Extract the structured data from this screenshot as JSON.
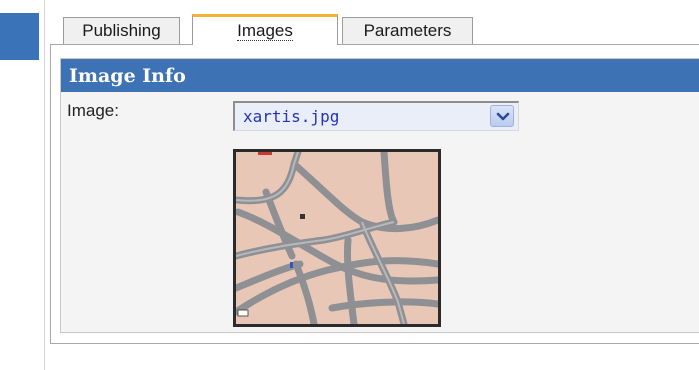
{
  "tabs": [
    {
      "label": "Publishing",
      "active": false
    },
    {
      "label": "Images",
      "active": true
    },
    {
      "label": "Parameters",
      "active": false
    }
  ],
  "image_info": {
    "title": "Image Info",
    "image_label": "Image:",
    "selected_image": "xartis.jpg"
  },
  "thumbnail": {
    "icon": "map-thumbnail"
  },
  "colors": {
    "accent": "#3d73b5",
    "active_tab_top": "#f2b531",
    "select_text": "#2432b8",
    "map_background": "#e8c7b6",
    "map_roads": "#8f9094"
  }
}
